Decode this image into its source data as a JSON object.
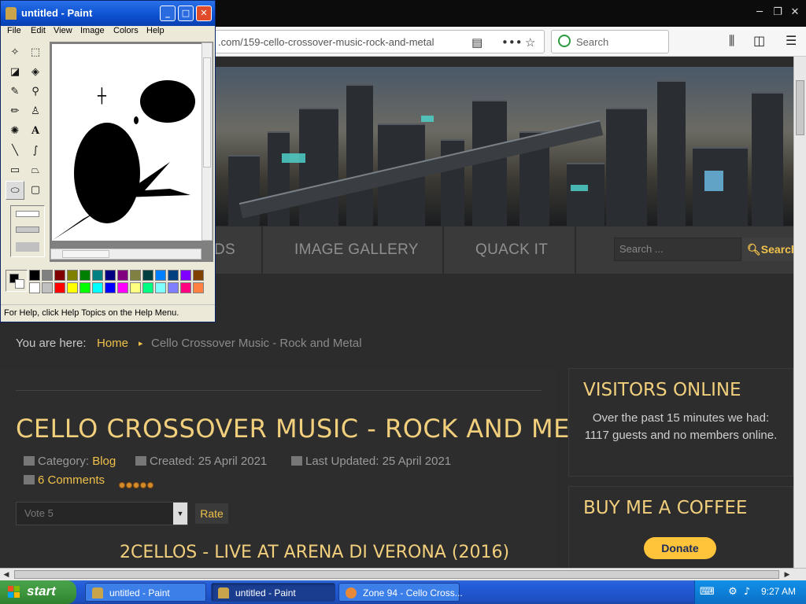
{
  "browser": {
    "url": ".com/159-cello-crossover-music-rock-and-metal",
    "search_placeholder": "Search"
  },
  "site": {
    "nav": [
      "DS",
      "IMAGE GALLERY",
      "QUACK IT"
    ],
    "search_placeholder": "Search ...",
    "search_button": "Search",
    "breadcrumb": {
      "label": "You are here:",
      "home": "Home",
      "current": "Cello Crossover Music - Rock and Metal"
    },
    "article": {
      "title": "CELLO CROSSOVER MUSIC - ROCK AND METAL",
      "category_label": "Category:",
      "category": "Blog",
      "created": "Created: 25 April 2021",
      "updated": "Last Updated: 25 April 2021",
      "comments": "6 Comments",
      "rating_stars": 5,
      "vote_selected": "Vote 5",
      "rate_button": "Rate",
      "video_title": "2CELLOS - LIVE AT ARENA DI VERONA (2016)"
    },
    "sidebar": {
      "visitors_title": "VISITORS ONLINE",
      "visitors_text": "Over the past 15 minutes we had: 1117 guests and no members online.",
      "coffee_title": "BUY ME A COFFEE",
      "donate": "Donate"
    },
    "colors": {
      "accent": "#f0c14b",
      "title": "#f1cf7c",
      "background": "#2c2c2c"
    }
  },
  "paint": {
    "title": "untitled - Paint",
    "menu": [
      "File",
      "Edit",
      "View",
      "Image",
      "Colors",
      "Help"
    ],
    "status": "For Help, click Help Topics on the Help Menu.",
    "palette_top": [
      "#000000",
      "#808080",
      "#800000",
      "#808000",
      "#008000",
      "#008080",
      "#000080",
      "#800080",
      "#808040",
      "#004040",
      "#0080ff",
      "#004080",
      "#8000ff",
      "#804000"
    ],
    "palette_bottom": [
      "#ffffff",
      "#c0c0c0",
      "#ff0000",
      "#ffff00",
      "#00ff00",
      "#00ffff",
      "#0000ff",
      "#ff00ff",
      "#ffff80",
      "#00ff80",
      "#80ffff",
      "#8080ff",
      "#ff0080",
      "#ff8040"
    ],
    "tools": [
      "free-select",
      "rect-select",
      "eraser",
      "fill",
      "color-picker",
      "magnifier",
      "pencil",
      "brush",
      "airbrush",
      "text",
      "line",
      "curve",
      "rectangle",
      "polygon",
      "ellipse",
      "rounded-rect"
    ]
  },
  "taskbar": {
    "start": "start",
    "tasks": [
      "untitled - Paint",
      "untitled - Paint",
      "Zone 94 - Cello Cross..."
    ],
    "clock": "9:27 AM"
  }
}
